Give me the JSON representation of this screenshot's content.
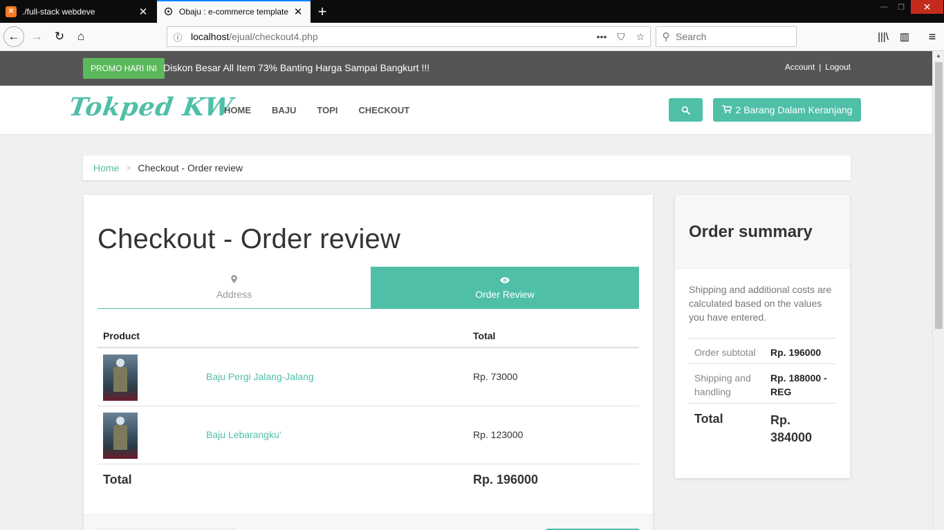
{
  "browser": {
    "tabs": [
      {
        "title": "./full-stack webdeve",
        "icon": "xampp-icon"
      },
      {
        "title": "Obaju : e-commerce template",
        "icon": "globe-icon"
      }
    ],
    "url_host": "localhost",
    "url_path": "/ejual/checkout4.php",
    "search_placeholder": "Search"
  },
  "topbar": {
    "promo_badge": "PROMO HARI INI",
    "promo_text": "Diskon Besar All Item 73% Banting Harga Sampai Bangkurt !!!",
    "account": "Account",
    "separator": "|",
    "logout": "Logout"
  },
  "header": {
    "logo": "Tokped KW",
    "nav": [
      "HOME",
      "BAJU",
      "TOPI",
      "CHECKOUT"
    ],
    "cart": "2 Barang Dalam Keranjang"
  },
  "breadcrumb": {
    "home": "Home",
    "separator": ">",
    "current": "Checkout - Order review"
  },
  "checkout": {
    "title": "Checkout - Order review",
    "steps": [
      {
        "label": "Address",
        "icon": "map-marker-icon"
      },
      {
        "label": "Order Review",
        "icon": "eye-icon"
      }
    ],
    "table": {
      "headers": [
        "Product",
        "Total"
      ],
      "rows": [
        {
          "name": "Baju Pergi Jalang-Jalang",
          "total": "Rp. 73000"
        },
        {
          "name": "Baju Lebarangku'",
          "total": "Rp. 123000"
        }
      ],
      "footer_label": "Total",
      "footer_value": "Rp. 196000"
    }
  },
  "summary": {
    "title": "Order summary",
    "note": "Shipping and additional costs are calculated based on the values you have entered.",
    "rows": [
      {
        "label": "Order subtotal",
        "value": "Rp. 196000"
      },
      {
        "label": "Shipping and handling",
        "value": "Rp. 188000 - REG"
      },
      {
        "label": "Total",
        "value": "Rp. 384000"
      }
    ]
  },
  "colors": {
    "accent": "#4fbfa8",
    "promo": "#5cb85c",
    "topbar": "#555555"
  }
}
